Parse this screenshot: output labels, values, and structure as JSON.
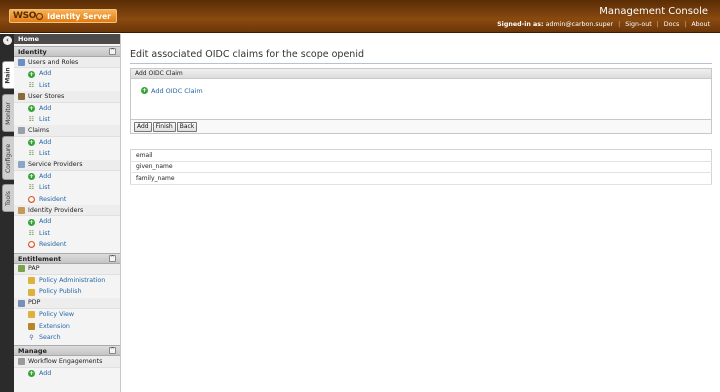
{
  "header": {
    "logo_wso": "WSO",
    "logo_product": "Identity Server",
    "console_title": "Management Console",
    "signed_in_label": "Signed-in as:",
    "signed_in_user": "admin@carbon.super",
    "links": [
      "Sign-out",
      "Docs",
      "About"
    ]
  },
  "sidetabs": [
    "Main",
    "Monitor",
    "Configure",
    "Tools"
  ],
  "menu": {
    "home": "Home",
    "sections": [
      {
        "title": "Identity",
        "groups": [
          {
            "label": "Users and Roles",
            "items": [
              {
                "label": "Add",
                "icon": "add-icon"
              },
              {
                "label": "List",
                "icon": "list-icon"
              }
            ]
          },
          {
            "label": "User Stores",
            "items": [
              {
                "label": "Add",
                "icon": "add-icon"
              },
              {
                "label": "List",
                "icon": "list-icon"
              }
            ]
          },
          {
            "label": "Claims",
            "items": [
              {
                "label": "Add",
                "icon": "add-icon"
              },
              {
                "label": "List",
                "icon": "list-icon"
              }
            ]
          },
          {
            "label": "Service Providers",
            "items": [
              {
                "label": "Add",
                "icon": "add-icon"
              },
              {
                "label": "List",
                "icon": "list-icon"
              },
              {
                "label": "Resident",
                "icon": "resident-icon"
              }
            ]
          },
          {
            "label": "Identity Providers",
            "items": [
              {
                "label": "Add",
                "icon": "add-icon"
              },
              {
                "label": "List",
                "icon": "list-icon"
              },
              {
                "label": "Resident",
                "icon": "resident-icon"
              }
            ]
          }
        ]
      },
      {
        "title": "Entitlement",
        "groups": [
          {
            "label": "PAP",
            "items": [
              {
                "label": "Policy Administration",
                "icon": "policy-icon"
              },
              {
                "label": "Policy Publish",
                "icon": "policy-icon"
              }
            ]
          },
          {
            "label": "PDP",
            "items": [
              {
                "label": "Policy View",
                "icon": "policy-icon"
              },
              {
                "label": "Extension",
                "icon": "extension-icon"
              },
              {
                "label": "Search",
                "icon": "search-icon"
              }
            ]
          }
        ]
      },
      {
        "title": "Manage",
        "groups": [
          {
            "label": "Workflow Engagements",
            "items": [
              {
                "label": "Add",
                "icon": "add-icon"
              }
            ]
          }
        ]
      }
    ]
  },
  "main": {
    "page_title": "Edit associated OIDC claims for the scope openid",
    "box_header": "Add OIDC Claim",
    "add_claim_link": "Add OIDC Claim",
    "buttons": {
      "add": "Add",
      "finish": "Finish",
      "back": "Back"
    },
    "claims": [
      "email",
      "given_name",
      "family_name"
    ]
  },
  "colors": {
    "header_brown": "#7a3e0b",
    "link_blue": "#2266aa",
    "add_green": "#35a335"
  }
}
